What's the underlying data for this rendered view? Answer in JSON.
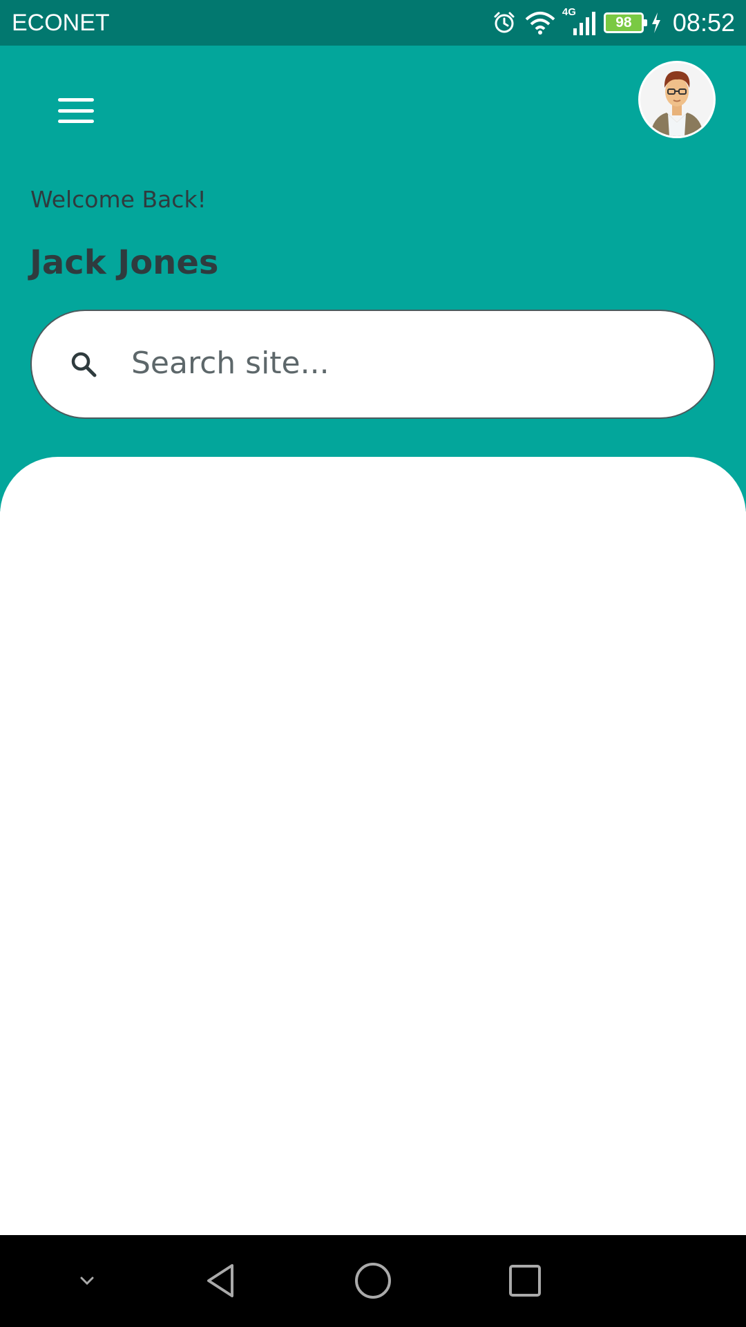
{
  "status_bar": {
    "carrier": "ECONET",
    "network_type": "4G",
    "battery_level": "98",
    "time": "08:52",
    "icons": [
      "alarm-icon",
      "wifi-icon",
      "signal-icon",
      "battery-icon",
      "charging-icon"
    ]
  },
  "header": {
    "welcome_text": "Welcome Back!",
    "user_name": "Jack Jones",
    "background_color": "#03a69b"
  },
  "search": {
    "placeholder": "Search site..."
  },
  "nav_bar": {
    "buttons": [
      "collapse-icon",
      "back-icon",
      "home-icon",
      "recents-icon"
    ]
  },
  "colors": {
    "status_bar": "#02786f",
    "accent": "#03a69b",
    "text_dark": "#2f3b3e"
  }
}
